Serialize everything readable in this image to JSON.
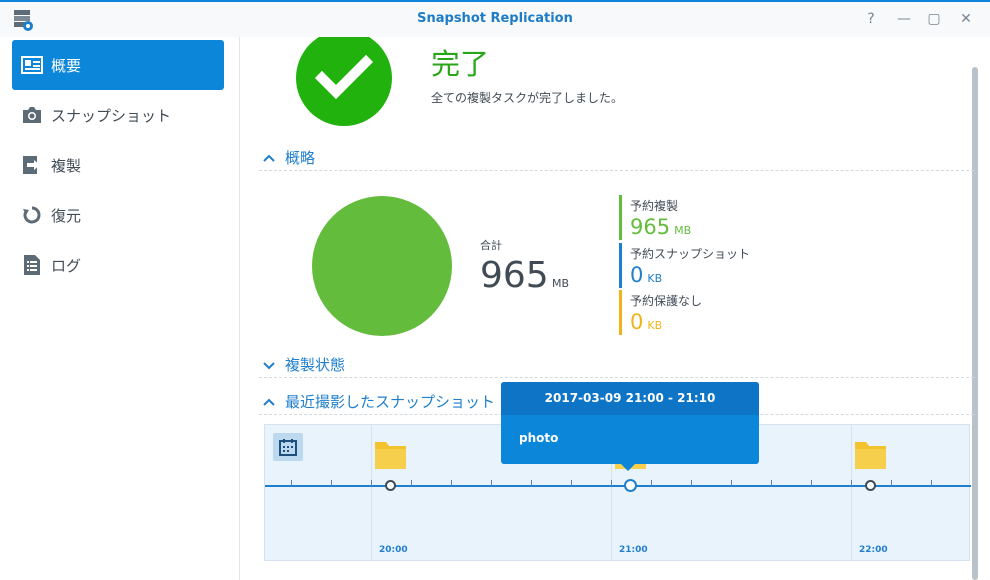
{
  "window": {
    "title": "Snapshot Replication",
    "controls": [
      "?",
      "—",
      "▢",
      "✕"
    ]
  },
  "sidebar": {
    "items": [
      {
        "label": "概要",
        "icon": "id-card-icon",
        "active": true
      },
      {
        "label": "スナップショット",
        "icon": "camera-icon",
        "active": false
      },
      {
        "label": "複製",
        "icon": "replicate-arrow-icon",
        "active": false
      },
      {
        "label": "復元",
        "icon": "restore-icon",
        "active": false
      },
      {
        "label": "ログ",
        "icon": "log-document-icon",
        "active": false
      }
    ]
  },
  "status": {
    "title": "完了",
    "description": "全ての複製タスクが完了しました。",
    "color": "#22b20d"
  },
  "sections": {
    "overview": "概略",
    "replication_status": "複製状態",
    "recent_snapshots": "最近撮影したスナップショット"
  },
  "usage": {
    "total_label": "合計",
    "total_value": "965",
    "total_unit": "MB",
    "legend": [
      {
        "name": "予約複製",
        "value": "965",
        "unit": "MB",
        "color": "#64bc3d"
      },
      {
        "name": "予約スナップショット",
        "value": "0",
        "unit": "KB",
        "color": "#1f7fcd"
      },
      {
        "name": "予約保護なし",
        "value": "0",
        "unit": "KB",
        "color": "#f2b31a"
      }
    ]
  },
  "timeline": {
    "times": [
      "20:00",
      "21:00",
      "22:00"
    ],
    "tooltip": {
      "date": "2017-03-09",
      "range": "21:00 - 21:10",
      "item": "photo"
    }
  }
}
